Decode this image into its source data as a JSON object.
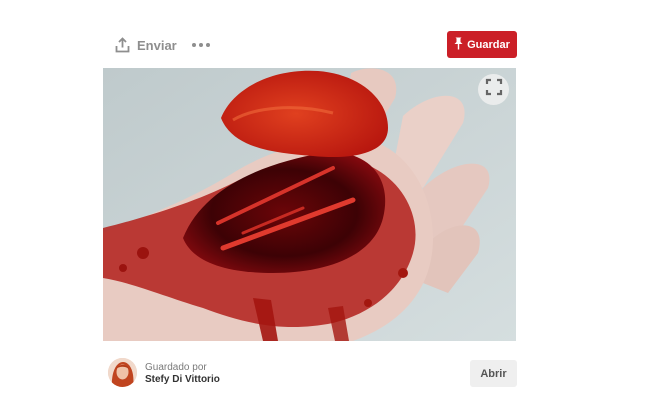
{
  "toolbar": {
    "send_label": "Enviar",
    "send_icon": "share-icon",
    "more_icon": "more-icon",
    "save_label": "Guardar",
    "save_icon": "pin-icon",
    "save_color": "#cb1f27"
  },
  "pin_image": {
    "expand_icon": "expand-icon"
  },
  "footer": {
    "saved_by_label": "Guardado por",
    "user_name": "Stefy Di Vittorio",
    "open_label": "Abrir"
  }
}
